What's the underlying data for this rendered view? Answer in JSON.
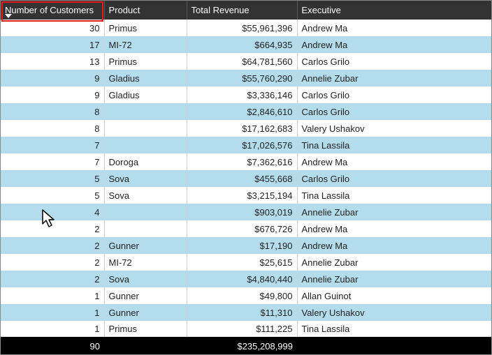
{
  "columns": {
    "customers": "Number of Customers",
    "product": "Product",
    "revenue": "Total Revenue",
    "executive": "Executive"
  },
  "rows": [
    {
      "customers": "30",
      "product": "Primus",
      "revenue": "$55,961,396",
      "executive": "Andrew Ma"
    },
    {
      "customers": "17",
      "product": "MI-72",
      "revenue": "$664,935",
      "executive": "Andrew Ma"
    },
    {
      "customers": "13",
      "product": "Primus",
      "revenue": "$64,781,560",
      "executive": "Carlos Grilo"
    },
    {
      "customers": "9",
      "product": "Gladius",
      "revenue": "$55,760,290",
      "executive": "Annelie Zubar"
    },
    {
      "customers": "9",
      "product": "Gladius",
      "revenue": "$3,336,146",
      "executive": "Carlos Grilo"
    },
    {
      "customers": "8",
      "product": "",
      "revenue": "$2,846,610",
      "executive": "Carlos Grilo"
    },
    {
      "customers": "8",
      "product": "",
      "revenue": "$17,162,683",
      "executive": "Valery Ushakov"
    },
    {
      "customers": "7",
      "product": "",
      "revenue": "$17,026,576",
      "executive": "Tina Lassila"
    },
    {
      "customers": "7",
      "product": "Doroga",
      "revenue": "$7,362,616",
      "executive": "Andrew Ma"
    },
    {
      "customers": "5",
      "product": "Sova",
      "revenue": "$455,668",
      "executive": "Carlos Grilo"
    },
    {
      "customers": "5",
      "product": "Sova",
      "revenue": "$3,215,194",
      "executive": "Tina Lassila"
    },
    {
      "customers": "4",
      "product": "",
      "revenue": "$903,019",
      "executive": "Annelie Zubar"
    },
    {
      "customers": "2",
      "product": "",
      "revenue": "$676,726",
      "executive": "Andrew Ma"
    },
    {
      "customers": "2",
      "product": "Gunner",
      "revenue": "$17,190",
      "executive": "Andrew Ma"
    },
    {
      "customers": "2",
      "product": "MI-72",
      "revenue": "$25,615",
      "executive": "Annelie Zubar"
    },
    {
      "customers": "2",
      "product": "Sova",
      "revenue": "$4,840,440",
      "executive": "Annelie Zubar"
    },
    {
      "customers": "1",
      "product": "Gunner",
      "revenue": "$49,800",
      "executive": "Allan Guinot"
    },
    {
      "customers": "1",
      "product": "Gunner",
      "revenue": "$11,310",
      "executive": "Valery Ushakov"
    },
    {
      "customers": "1",
      "product": "Primus",
      "revenue": "$111,225",
      "executive": "Tina Lassila"
    }
  ],
  "totals": {
    "customers": "90",
    "revenue": "$235,208,999"
  }
}
